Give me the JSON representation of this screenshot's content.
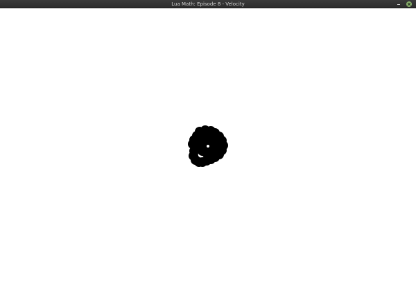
{
  "window": {
    "title": "Lua Math: Episode 8 - Velocity",
    "controls": {
      "minimize_icon": "minimize-icon",
      "close_icon": "close-icon"
    }
  },
  "canvas": {
    "background": "#ffffff",
    "trail_color": "#000000",
    "center_dot_color": "#ffffff"
  }
}
